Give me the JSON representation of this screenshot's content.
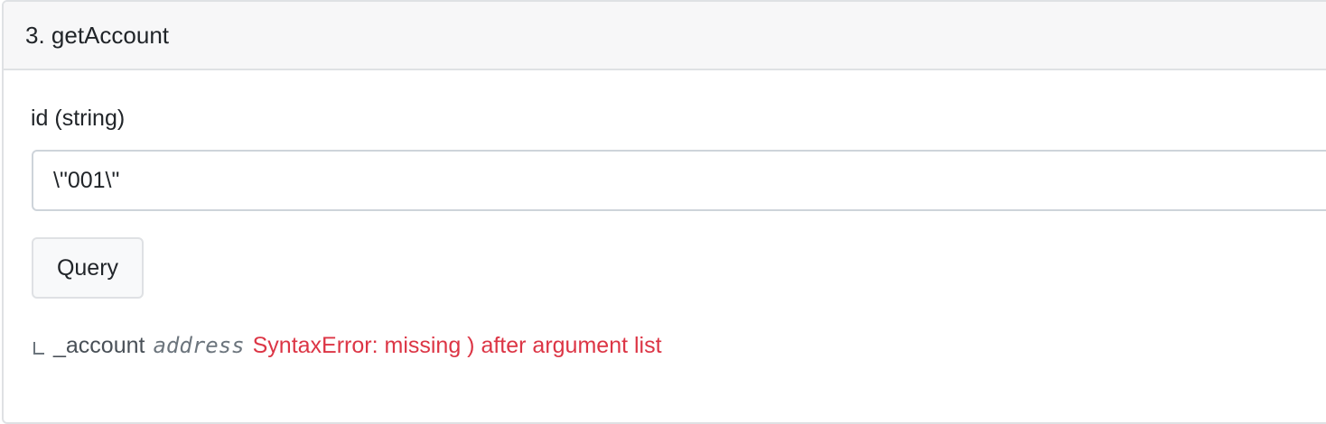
{
  "header": {
    "title": "3. getAccount"
  },
  "form": {
    "field_label": "id (string)",
    "field_value": "\\\"001\\\"",
    "query_button_label": "Query"
  },
  "result": {
    "icon": "corner-arrow-icon",
    "param_name": "_account",
    "param_type": "address",
    "error_text": "SyntaxError: missing ) after argument list",
    "error_color": "#dc3545"
  }
}
